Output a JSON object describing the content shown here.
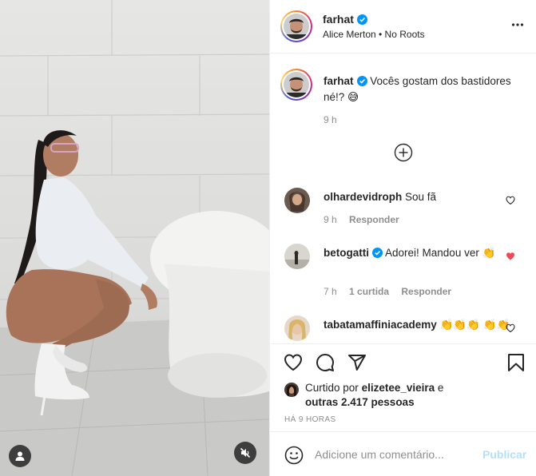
{
  "post": {
    "author": "farhat",
    "music": "Alice Merton • No Roots",
    "caption_user": "farhat",
    "caption_text": "Vocês gostam dos bastidores né!? 😅",
    "caption_time": "9 h"
  },
  "comments": [
    {
      "user": "olhardevidroph",
      "text": "Sou fã",
      "time": "9 h",
      "likes": "",
      "reply": "Responder",
      "liked": false
    },
    {
      "user": "betogatti",
      "text": "Adorei! Mandou ver 👏",
      "time": "7 h",
      "likes": "1 curtida",
      "reply": "Responder",
      "liked": true
    },
    {
      "user": "tabatamaffiniacademy",
      "text": "👏👏👏 👏👏",
      "time": "",
      "likes": "",
      "reply": "",
      "liked": false
    }
  ],
  "likes": {
    "prefix": "Curtido por",
    "user": "elizetee_vieira",
    "joiner": "e",
    "others": "outras 2.417 pessoas"
  },
  "timestamp": "HÁ 9 HORAS",
  "composer": {
    "placeholder": "Adicione um comentário...",
    "publish": "Publicar"
  },
  "icons": {
    "header_more": "more-options-icon",
    "verified": "verified-badge-icon",
    "load_more": "plus-circle-icon",
    "like": "heart-icon",
    "comment": "comment-bubble-icon",
    "share": "paper-plane-icon",
    "save": "bookmark-icon",
    "emoji": "smiley-icon",
    "tag": "user-tag-icon",
    "mute": "muted-speaker-icon"
  },
  "colors": {
    "accent": "#0095f6",
    "publish_disabled": "#b2dffc",
    "liked_red": "#ed4956",
    "muted_text": "#8e8e8e"
  }
}
